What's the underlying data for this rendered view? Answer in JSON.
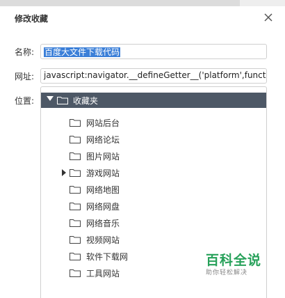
{
  "dialog": {
    "title": "修改收藏",
    "name_label": "名称:",
    "name_value": "百度大文件下载代码",
    "url_label": "网址:",
    "url_value": "javascript:navigator.__defineGetter__('platform',function()",
    "location_label": "位置:"
  },
  "tree": {
    "root": "收藏夹",
    "items": [
      {
        "label": "网站后台",
        "expandable": false
      },
      {
        "label": "网络论坛",
        "expandable": false
      },
      {
        "label": "图片网站",
        "expandable": false
      },
      {
        "label": "游戏网站",
        "expandable": true
      },
      {
        "label": "网络地图",
        "expandable": false
      },
      {
        "label": "网络网盘",
        "expandable": false
      },
      {
        "label": "网络音乐",
        "expandable": false
      },
      {
        "label": "视频网站",
        "expandable": false
      },
      {
        "label": "软件下载网",
        "expandable": false
      },
      {
        "label": "工具网站",
        "expandable": false
      }
    ]
  },
  "watermark": {
    "title": "百科全说",
    "subtitle": "助你轻松解决"
  },
  "colors": {
    "root_bg": "#4d5866",
    "selection": "#3b7fd8",
    "watermark": "#27a15a"
  }
}
